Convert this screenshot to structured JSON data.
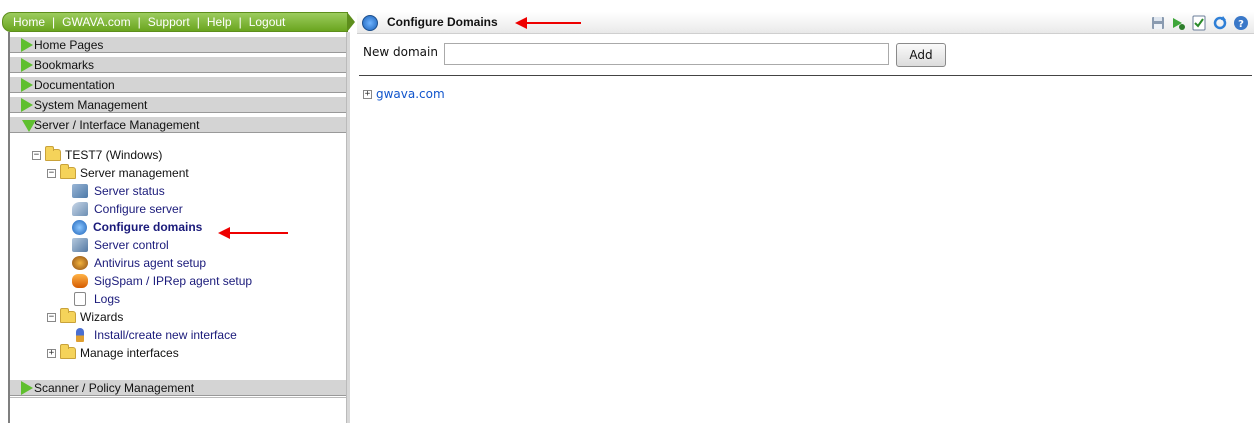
{
  "topnav": {
    "links": [
      "Home",
      "GWAVA.com",
      "Support",
      "Help",
      "Logout"
    ],
    "separator": "|"
  },
  "accordion": [
    {
      "label": "Home Pages",
      "expanded": false
    },
    {
      "label": "Bookmarks",
      "expanded": false
    },
    {
      "label": "Documentation",
      "expanded": false
    },
    {
      "label": "System Management",
      "expanded": false
    },
    {
      "label": "Server / Interface Management",
      "expanded": true
    },
    {
      "label": "Scanner / Policy Management",
      "expanded": false
    }
  ],
  "tree": {
    "root": {
      "label": "TEST7 (Windows)",
      "toggle": "−"
    },
    "server_management": {
      "label": "Server management",
      "toggle": "−"
    },
    "items": [
      {
        "label": "Server status",
        "icon": "server-status-icon"
      },
      {
        "label": "Configure server",
        "icon": "configure-server-icon"
      },
      {
        "label": "Configure domains",
        "icon": "globe-icon",
        "selected": true
      },
      {
        "label": "Server control",
        "icon": "server-control-icon"
      },
      {
        "label": "Antivirus agent setup",
        "icon": "antivirus-icon"
      },
      {
        "label": "SigSpam / IPRep agent setup",
        "icon": "spam-icon"
      },
      {
        "label": "Logs",
        "icon": "log-document-icon"
      }
    ],
    "wizards": {
      "label": "Wizards",
      "toggle": "−"
    },
    "wizard_item": {
      "label": "Install/create new interface",
      "icon": "wizard-icon"
    },
    "manage_interfaces": {
      "label": "Manage interfaces",
      "toggle": "+"
    }
  },
  "main": {
    "title": "Configure Domains",
    "new_domain_label": "New domain",
    "new_domain_value": "",
    "add_label": "Add",
    "domains": [
      {
        "name": "gwava.com",
        "toggle": "+"
      }
    ],
    "toolbar": [
      "save-icon",
      "run-icon",
      "checklist-icon",
      "refresh-icon",
      "help-icon"
    ]
  },
  "colors": {
    "accent": "#6aa51f",
    "arrow": "#e00000",
    "link": "#1155cc"
  }
}
